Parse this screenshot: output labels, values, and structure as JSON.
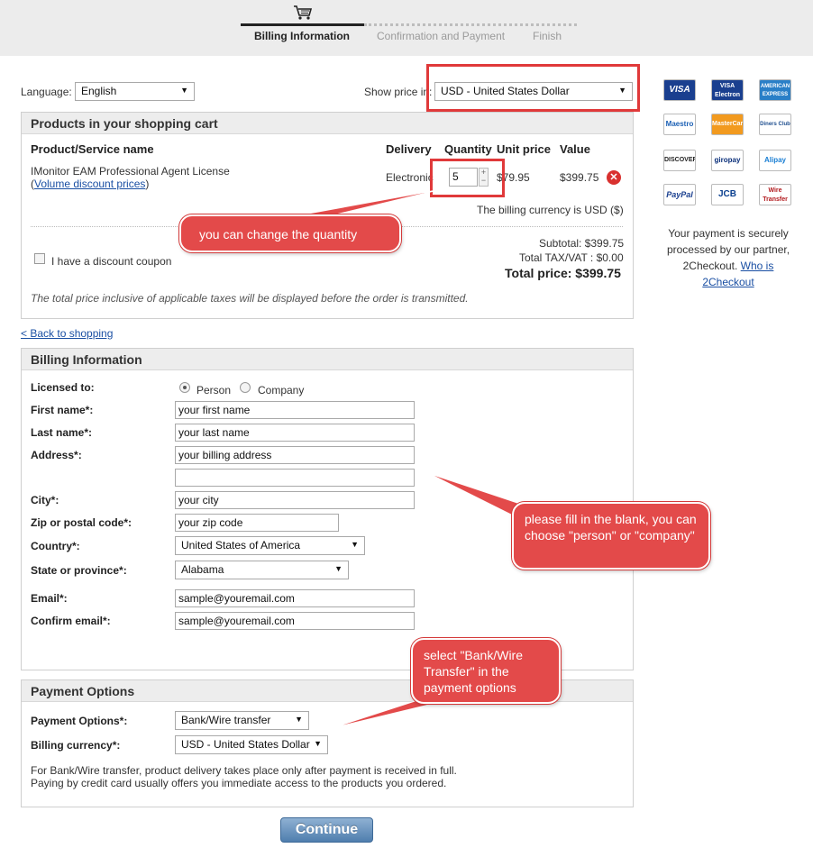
{
  "steps": [
    {
      "label": "Billing Information"
    },
    {
      "label": "Confirmation and Payment"
    },
    {
      "label": "Finish"
    }
  ],
  "top": {
    "language_label": "Language:",
    "language_value": "English",
    "price_label": "Show price in:",
    "currency_value": "USD - United States Dollar"
  },
  "cart": {
    "title": "Products in your shopping cart",
    "col_product": "Product/Service name",
    "col_delivery": "Delivery",
    "col_quantity": "Quantity",
    "col_unit": "Unit price",
    "col_value": "Value",
    "product_name": "IMonitor EAM Professional Agent License",
    "volume_link": "Volume discount prices",
    "delivery": "Electronic",
    "quantity": "5",
    "unit_price": "$79.95",
    "value": "$399.75",
    "billing_currency_note": "The billing currency is USD ($)",
    "coupon_label": "I have a discount coupon",
    "subtotal": "Subtotal: $399.75",
    "tax": "Total TAX/VAT : $0.00",
    "total": "Total price: $399.75",
    "footnote": "The total price inclusive of applicable taxes will be displayed before the order is transmitted."
  },
  "back_link": "< Back to shopping",
  "billing": {
    "title": "Billing Information",
    "licensed_label": "Licensed to:",
    "person_label": "Person",
    "company_label": "Company",
    "first_name_label": "First name*:",
    "first_name_value": "your first name",
    "last_name_label": "Last name*:",
    "last_name_value": "your last name",
    "address_label": "Address*:",
    "address_value": "your billing address",
    "address2_value": "",
    "city_label": "City*:",
    "city_value": "your city",
    "zip_label": "Zip or postal code*:",
    "zip_value": "your zip code",
    "country_label": "Country*:",
    "country_value": "United States of America",
    "state_label": "State or province*:",
    "state_value": "Alabama",
    "email_label": "Email*:",
    "email_value": "sample@youremail.com",
    "confirm_email_label": "Confirm email*:",
    "confirm_email_value": "sample@youremail.com"
  },
  "payment": {
    "title": "Payment Options",
    "options_label": "Payment Options*:",
    "options_value": "Bank/Wire transfer",
    "currency_label": "Billing currency*:",
    "currency_value": "USD - United States Dollar",
    "note1": "For Bank/Wire transfer, product delivery takes place only after payment is received in full.",
    "note2": "Paying by credit card usually offers you immediate access to the products you ordered."
  },
  "continue_label": "Continue",
  "sidebar": {
    "secure_text": "Your payment is securely processed by our partner, 2Checkout.",
    "who_link": "Who is 2Checkout",
    "cards": [
      "VISA",
      "VISA Electron",
      "AMERICAN EXPRESS",
      "Maestro",
      "MasterCard",
      "Diners Club",
      "DISCOVER",
      "giropay",
      "Alipay",
      "PayPal",
      "JCB",
      "Wire Transfer"
    ]
  },
  "callouts": {
    "quantity": "you can change the quantity",
    "fill": "please fill in the blank, you can choose \"person\" or \"company\"",
    "payment": "select \"Bank/Wire Transfer\" in the payment options"
  },
  "colors": {
    "callout": "#e34a4a",
    "link": "#1a4fa3",
    "button": "#4f7eae"
  }
}
